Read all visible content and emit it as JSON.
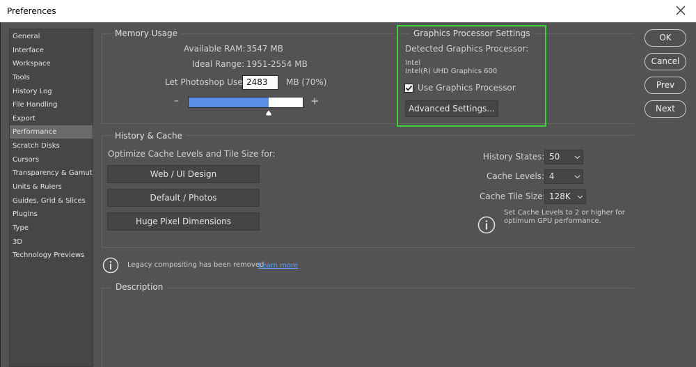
{
  "window": {
    "title": "Preferences"
  },
  "sidebar": {
    "items": [
      {
        "label": "General"
      },
      {
        "label": "Interface"
      },
      {
        "label": "Workspace"
      },
      {
        "label": "Tools"
      },
      {
        "label": "History Log"
      },
      {
        "label": "File Handling"
      },
      {
        "label": "Export"
      },
      {
        "label": "Performance",
        "selected": true
      },
      {
        "label": "Scratch Disks"
      },
      {
        "label": "Cursors"
      },
      {
        "label": "Transparency & Gamut"
      },
      {
        "label": "Units & Rulers"
      },
      {
        "label": "Guides, Grid & Slices"
      },
      {
        "label": "Plugins"
      },
      {
        "label": "Type"
      },
      {
        "label": "3D"
      },
      {
        "label": "Technology Previews"
      }
    ]
  },
  "memory": {
    "title": "Memory Usage",
    "available_label": "Available RAM:",
    "available_value": "3547 MB",
    "ideal_label": "Ideal Range:",
    "ideal_value": "1951-2554 MB",
    "let_label": "Let Photoshop Use:",
    "let_value": "2483",
    "let_unit": "MB (70%)",
    "minus": "–",
    "plus": "+",
    "slider_fraction": 0.7
  },
  "gpu": {
    "title": "Graphics Processor Settings",
    "detected_label": "Detected Graphics Processor:",
    "vendor": "Intel",
    "model": "Intel(R) UHD Graphics 600",
    "use_label": "Use Graphics Processor",
    "use_checked": true,
    "advanced_button": "Advanced Settings..."
  },
  "history": {
    "title": "History & Cache",
    "optimize_label": "Optimize Cache Levels and Tile Size for:",
    "buttons": [
      "Web / UI Design",
      "Default / Photos",
      "Huge Pixel Dimensions"
    ],
    "states_label": "History States:",
    "states_value": "50",
    "levels_label": "Cache Levels:",
    "levels_value": "4",
    "tile_label": "Cache Tile Size:",
    "tile_value": "128K",
    "hint_line1": "Set Cache Levels to 2 or higher for",
    "hint_line2": "optimum GPU performance."
  },
  "legacy": {
    "text": "Legacy compositing has been removed",
    "link": "Learn more"
  },
  "description": {
    "title": "Description"
  },
  "buttons": {
    "ok": "OK",
    "cancel": "Cancel",
    "prev": "Prev",
    "next": "Next"
  },
  "colors": {
    "accent_box": "#3fd23f",
    "slider_fill": "#5b8ee6",
    "link": "#5aa0ff"
  }
}
